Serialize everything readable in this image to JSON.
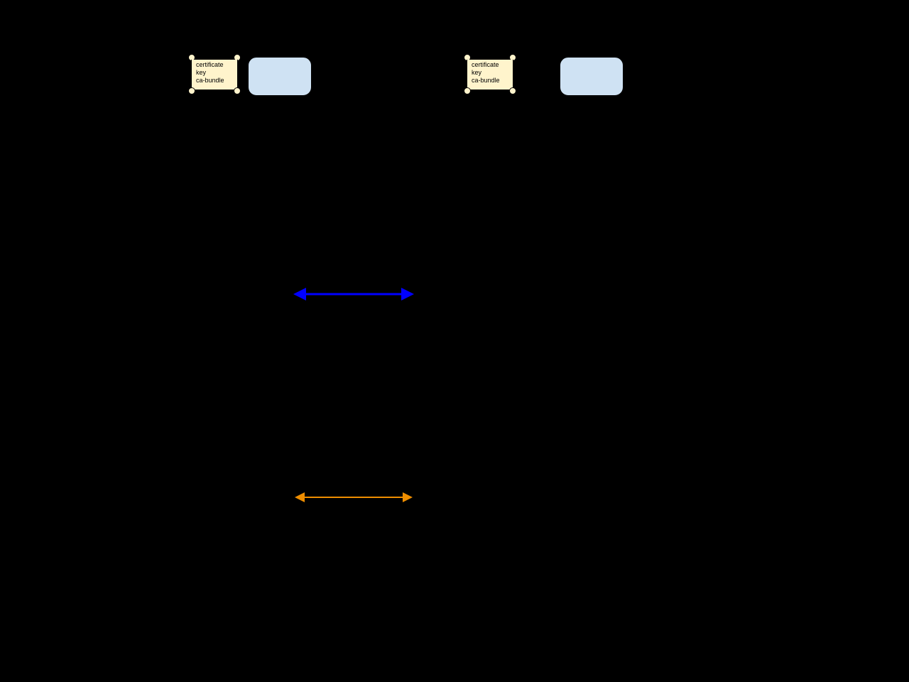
{
  "scrolls": {
    "left": {
      "line1": "certificate",
      "line2": "key",
      "line3": "ca-bundle"
    },
    "right": {
      "line1": "certificate",
      "line2": "key",
      "line3": "ca-bundle"
    }
  },
  "arrows": {
    "blue_color": "#0000ff",
    "orange_color": "#ee8d00"
  }
}
